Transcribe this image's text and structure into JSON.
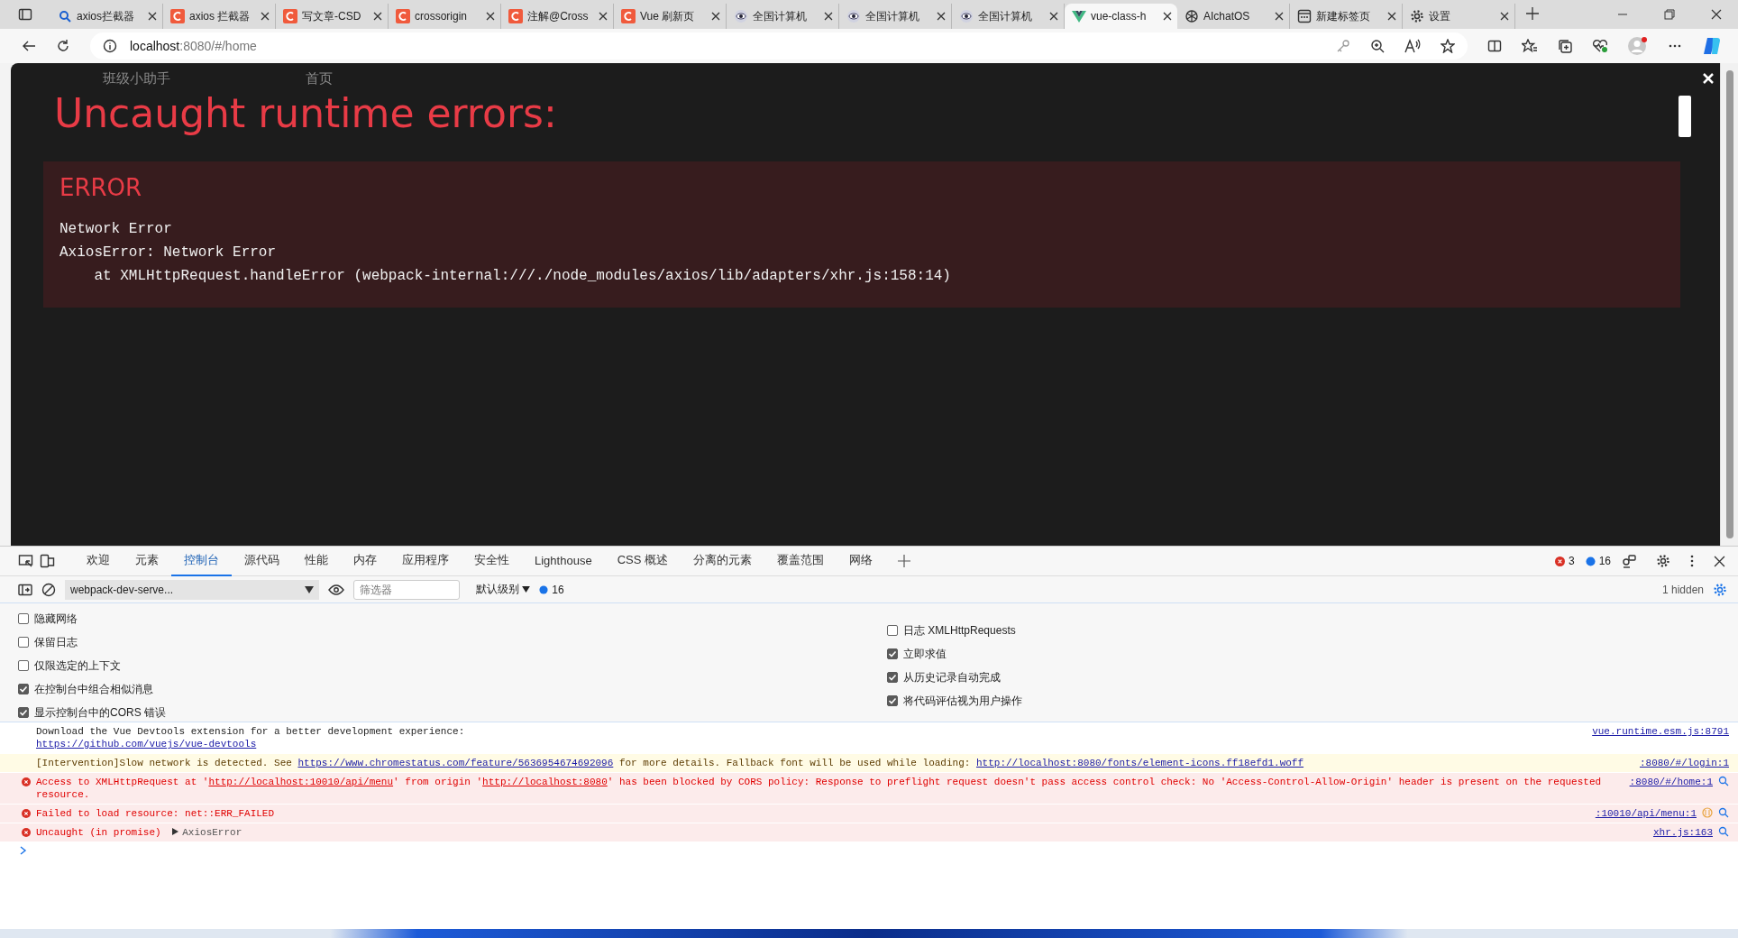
{
  "browser": {
    "tabs": [
      {
        "title": "axios拦截器",
        "kind": "search",
        "selected": false
      },
      {
        "title": "axios 拦截器",
        "kind": "csdn",
        "selected": false
      },
      {
        "title": "写文章-CSD",
        "kind": "csdn",
        "selected": false
      },
      {
        "title": "crossorigin",
        "kind": "csdn",
        "selected": false
      },
      {
        "title": "注解@Cross",
        "kind": "csdn",
        "selected": false
      },
      {
        "title": "Vue 刷新页",
        "kind": "csdn",
        "selected": false
      },
      {
        "title": "全国计算机",
        "kind": "eye",
        "selected": false
      },
      {
        "title": "全国计算机",
        "kind": "eye",
        "selected": false
      },
      {
        "title": "全国计算机",
        "kind": "eye",
        "selected": false
      },
      {
        "title": "vue-class-h",
        "kind": "vue",
        "selected": true
      },
      {
        "title": "AIchatOS",
        "kind": "knot",
        "selected": false
      },
      {
        "title": "新建标签页",
        "kind": "newtab",
        "selected": false
      },
      {
        "title": "设置",
        "kind": "gear",
        "selected": false
      }
    ],
    "address": {
      "host": "localhost",
      "path": ":8080/#/home"
    }
  },
  "page": {
    "background_texts": [
      "班级小助手",
      "首页"
    ],
    "overlay": {
      "title": "Uncaught runtime errors:",
      "error_label": "ERROR",
      "message": "Network Error\nAxiosError: Network Error\n    at XMLHttpRequest.handleError (webpack-internal:///./node_modules/axios/lib/adapters/xhr.js:158:14)"
    }
  },
  "devtools": {
    "tabs": [
      {
        "label": "欢迎",
        "selected": false
      },
      {
        "label": "元素",
        "selected": false
      },
      {
        "label": "控制台",
        "selected": true
      },
      {
        "label": "源代码",
        "selected": false
      },
      {
        "label": "性能",
        "selected": false
      },
      {
        "label": "内存",
        "selected": false
      },
      {
        "label": "应用程序",
        "selected": false
      },
      {
        "label": "安全性",
        "selected": false
      },
      {
        "label": "Lighthouse",
        "selected": false
      },
      {
        "label": "CSS 概述",
        "selected": false
      },
      {
        "label": "分离的元素",
        "selected": false
      },
      {
        "label": "覆盖范围",
        "selected": false
      },
      {
        "label": "网络",
        "selected": false
      }
    ],
    "error_count": "3",
    "info_count": "16",
    "console_toolbar": {
      "context": "webpack-dev-serve...",
      "filter_placeholder": "筛选器",
      "level": "默认级别",
      "info_count": "16",
      "hidden": "1 hidden"
    },
    "settings_left": [
      {
        "label": "隐藏网络",
        "checked": false
      },
      {
        "label": "保留日志",
        "checked": false
      },
      {
        "label": "仅限选定的上下文",
        "checked": false
      },
      {
        "label": "在控制台中组合相似消息",
        "checked": true
      },
      {
        "label": "显示控制台中的CORS 错误",
        "checked": true
      }
    ],
    "settings_right": [
      {
        "label": "日志 XMLHttpRequests",
        "checked": false
      },
      {
        "label": "立即求值",
        "checked": true
      },
      {
        "label": "从历史记录自动完成",
        "checked": true
      },
      {
        "label": "将代码评估视为用户操作",
        "checked": true
      }
    ],
    "messages": [
      {
        "kind": "info",
        "parts": [
          {
            "text": "Download the Vue Devtools extension for a better development experience:\n"
          },
          {
            "link": "https://github.com/vuejs/vue-devtools"
          }
        ],
        "source": "vue.runtime.esm.js:8791"
      },
      {
        "kind": "warning",
        "parts": [
          {
            "text": "[Intervention]Slow network is detected. See "
          },
          {
            "link": "https://www.chromestatus.com/feature/5636954674692096"
          },
          {
            "text": " for more details. Fallback font will be used while loading: "
          },
          {
            "link": "http://localhost:8080/fonts/element-icons.ff18efd1.woff"
          }
        ],
        "source": ":8080/#/login:1"
      },
      {
        "kind": "error",
        "parts": [
          {
            "text": "Access to XMLHttpRequest at '"
          },
          {
            "link": "http://localhost:10010/api/menu"
          },
          {
            "text": "' from origin '"
          },
          {
            "link": "http://localhost:8080"
          },
          {
            "text": "' has been blocked by CORS policy: Response to preflight request doesn't pass access control check: No 'Access-Control-Allow-Origin' header is present on the requested resource."
          }
        ],
        "source": ":8080/#/home:1",
        "search": true
      },
      {
        "kind": "error",
        "parts": [
          {
            "text": "Failed to load resource: net::ERR_FAILED"
          }
        ],
        "source": ":10010/api/menu:1",
        "network": true,
        "search": true
      },
      {
        "kind": "error",
        "parts": [
          {
            "text": "Uncaught (in promise) "
          },
          {
            "object": "AxiosError"
          }
        ],
        "source": "xhr.js:163",
        "search": true
      }
    ]
  }
}
